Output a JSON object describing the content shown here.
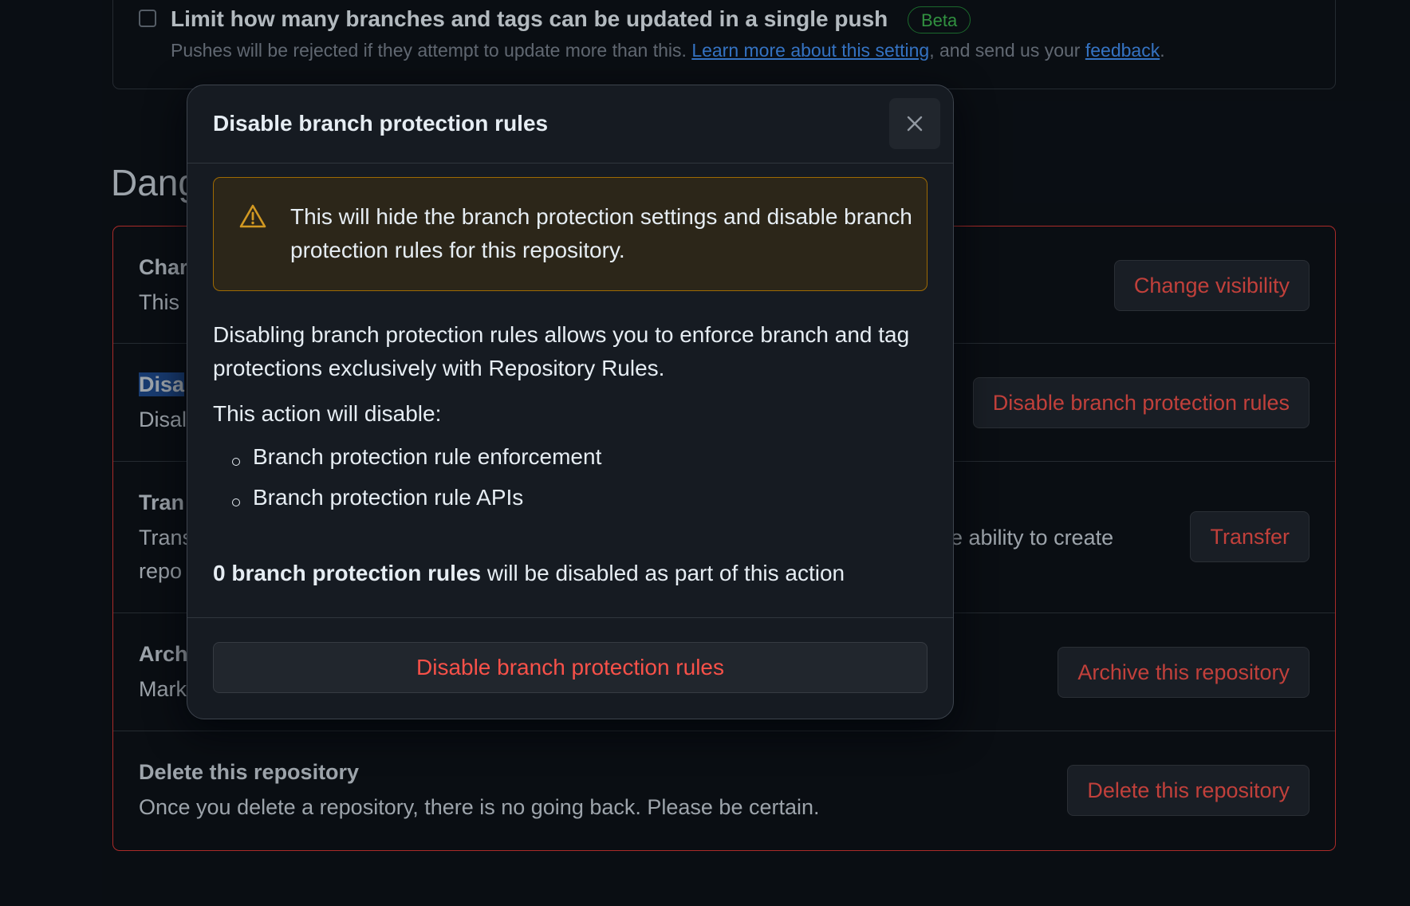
{
  "push_limit": {
    "title": "Limit how many branches and tags can be updated in a single push",
    "badge": "Beta",
    "description_before": "Pushes will be rejected if they attempt to update more than this. ",
    "learn_more_link": "Learn more about this setting",
    "description_middle": ", and send us your ",
    "feedback_link": "feedback",
    "description_after": "."
  },
  "danger_zone": {
    "heading": "Dang",
    "rows": [
      {
        "title": "Char",
        "description": "This",
        "button": "Change visibility"
      },
      {
        "title": "Disa",
        "description": "Disal",
        "button": "Disable branch protection rules"
      },
      {
        "title": "Tran",
        "description_line1": "Trans",
        "description_line1_tail": "e ability to create",
        "description_line2": "repo",
        "button": "Transfer"
      },
      {
        "title": "Arch",
        "description": "Mark",
        "button": "Archive this repository"
      },
      {
        "title": "Delete this repository",
        "description": "Once you delete a repository, there is no going back. Please be certain.",
        "button": "Delete this repository"
      }
    ]
  },
  "modal": {
    "title": "Disable branch protection rules",
    "close_icon": "x-icon",
    "warning": {
      "icon": "alert-triangle-icon",
      "text": "This will hide the branch protection settings and disable branch protection rules for this repository."
    },
    "body_text": "Disabling branch protection rules allows you to enforce branch and tag protections exclusively with Repository Rules.",
    "action_intro": "This action will disable:",
    "disable_items": [
      "Branch protection rule enforcement",
      "Branch protection rule APIs"
    ],
    "count_bold": "0 branch protection rules",
    "count_rest": " will be disabled as part of this action",
    "confirm_button": "Disable branch protection rules"
  },
  "colors": {
    "background": "#0d1117",
    "modal_background": "#161b22",
    "danger_text": "#f85149",
    "link": "#4493f8",
    "success_badge": "#3fb950",
    "warning_border": "#9e6a03",
    "warning_icon": "#d29922"
  }
}
